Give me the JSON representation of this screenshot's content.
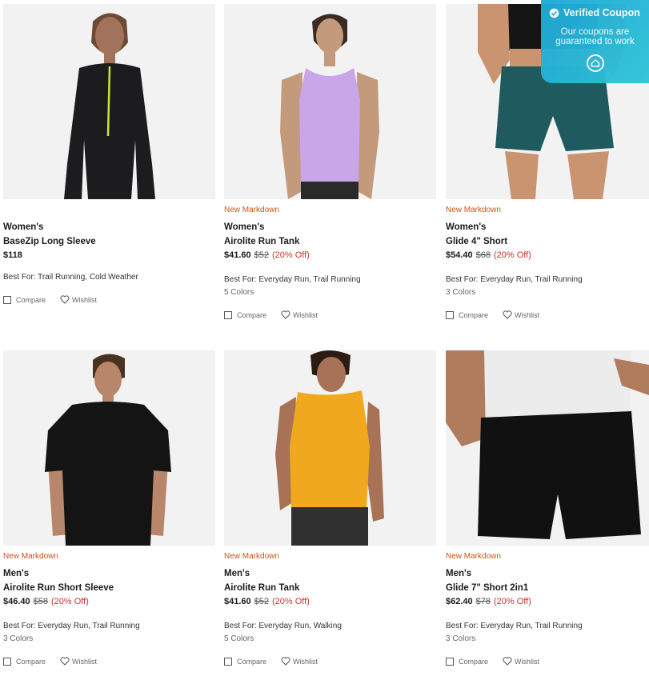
{
  "coupon": {
    "title": "Verified Coupon",
    "line1": "Our coupons are",
    "line2": "guaranteed to work"
  },
  "labels": {
    "compare": "Compare",
    "wishlist": "Wishlist"
  },
  "products": [
    {
      "badge": "",
      "gender": "Women's",
      "name": "BaseZip Long Sleeve",
      "price": "$118",
      "original_price": "",
      "discount": "",
      "best_for": "Best For: Trail Running, Cold Weather",
      "colors": "",
      "garment_color": "#1c1c1e"
    },
    {
      "badge": "New Markdown",
      "gender": "Women's",
      "name": "Airolite Run Tank",
      "price": "$41.60",
      "original_price": "$52",
      "discount": "(20% Off)",
      "best_for": "Best For: Everyday Run, Trail Running",
      "colors": "5 Colors",
      "garment_color": "#c9a6e8"
    },
    {
      "badge": "New Markdown",
      "gender": "Women's",
      "name": "Glide 4\" Short",
      "price": "$54.40",
      "original_price": "$68",
      "discount": "(20% Off)",
      "best_for": "Best For: Everyday Run, Trail Running",
      "colors": "3 Colors",
      "garment_color": "#1f5a5e"
    },
    {
      "badge": "New Markdown",
      "gender": "Men's",
      "name": "Airolite Run Short Sleeve",
      "price": "$46.40",
      "original_price": "$58",
      "discount": "(20% Off)",
      "best_for": "Best For: Everyday Run, Trail Running",
      "colors": "3 Colors",
      "garment_color": "#141414"
    },
    {
      "badge": "New Markdown",
      "gender": "Men's",
      "name": "Airolite Run Tank",
      "price": "$41.60",
      "original_price": "$52",
      "discount": "(20% Off)",
      "best_for": "Best For: Everyday Run, Walking",
      "colors": "5 Colors",
      "garment_color": "#f0a91e"
    },
    {
      "badge": "New Markdown",
      "gender": "Men's",
      "name": "Glide 7\" Short 2in1",
      "price": "$62.40",
      "original_price": "$78",
      "discount": "(20% Off)",
      "best_for": "Best For: Everyday Run, Trail Running",
      "colors": "3 Colors",
      "garment_color": "#111111"
    }
  ]
}
